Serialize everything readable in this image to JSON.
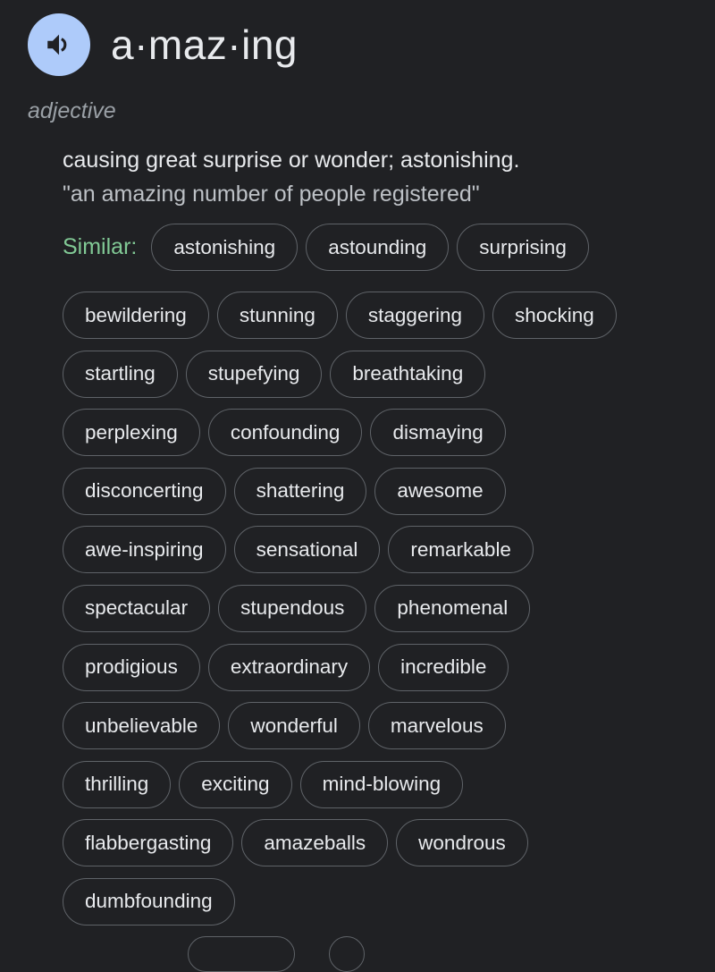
{
  "entry": {
    "word": "a·maz·ing",
    "speaker_icon": "volume-up-icon",
    "part_of_speech": "adjective",
    "definition": "causing great surprise or wonder; astonishing.",
    "example": "\"an amazing number of people registered\""
  },
  "similar": {
    "label": "Similar:",
    "first_row": [
      "astonishing",
      "astounding",
      "surprising"
    ],
    "rows": [
      [
        "bewildering",
        "stunning",
        "staggering",
        "shocking"
      ],
      [
        "startling",
        "stupefying",
        "breathtaking"
      ],
      [
        "perplexing",
        "confounding",
        "dismaying"
      ],
      [
        "disconcerting",
        "shattering",
        "awesome"
      ],
      [
        "awe-inspiring",
        "sensational",
        "remarkable"
      ],
      [
        "spectacular",
        "stupendous",
        "phenomenal"
      ],
      [
        "prodigious",
        "extraordinary",
        "incredible"
      ],
      [
        "unbelievable",
        "wonderful",
        "marvelous"
      ],
      [
        "thrilling",
        "exciting",
        "mind-blowing"
      ],
      [
        "flabbergasting",
        "amazeballs",
        "wondrous"
      ],
      [
        "dumbfounding"
      ]
    ]
  },
  "colors": {
    "background": "#202124",
    "speaker_button": "#aecbfa",
    "similar_label": "#81c995",
    "chip_border": "#5f6368",
    "text_primary": "#e8eaed",
    "text_secondary": "#9aa0a6"
  }
}
